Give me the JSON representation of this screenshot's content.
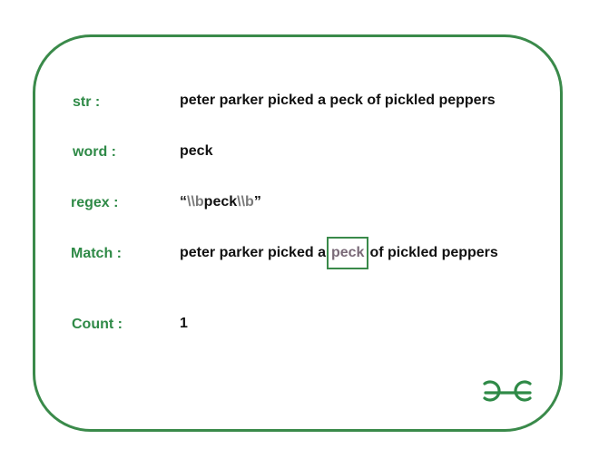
{
  "rows": {
    "str": {
      "label": "str :",
      "value": "peter parker picked a peck of pickled peppers"
    },
    "word": {
      "label": "word :",
      "value": "peck"
    },
    "regex": {
      "label": "regex :",
      "open_quote": "“",
      "boundary_start": "\\\\b",
      "word": "peck",
      "boundary_end": "\\\\b",
      "close_quote": "”"
    },
    "match": {
      "label": "Match :",
      "before": "peter parker picked a",
      "highlight": "peck",
      "after": "of pickled peppers"
    },
    "count": {
      "label": "Count :",
      "value": "1"
    }
  },
  "colors": {
    "accent": "#3a8a4a",
    "label_text": "#2f8a47",
    "value_text": "#111111",
    "muted_text": "#7a7a7a"
  },
  "logo_icon": "geeksforgeeks-logo-icon"
}
